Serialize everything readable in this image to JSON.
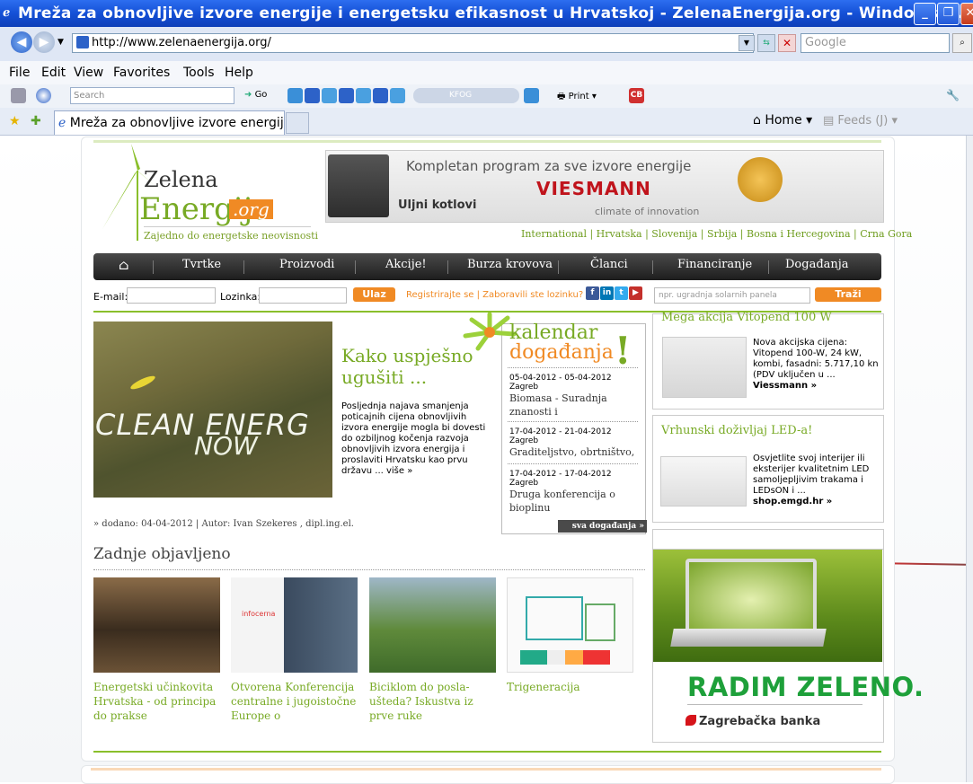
{
  "window": {
    "title": "Mreža za obnovljive izvore energije i energetsku efikasnost u Hrvatskoj - ZelenaEnergija.org - Windows I..."
  },
  "address_bar": {
    "url": "http://www.zelenaenergija.org/",
    "search_placeholder": "Google"
  },
  "menu": [
    "File",
    "Edit",
    "View",
    "Favorites",
    "Tools",
    "Help"
  ],
  "toolbar": {
    "search_placeholder": "Search",
    "go_label": "Go",
    "kfog_label": "KFOG",
    "print_label": "Print"
  },
  "tabs": {
    "active_label": "Mreža za obnovljive izvore energije ...",
    "home_label": "Home",
    "feeds_label": "Feeds (J)"
  },
  "site": {
    "logo_word1": "Zelena",
    "logo_word2": "Energija",
    "logo_tld": ".org",
    "tagline": "Zajedno do energetske neovisnosti",
    "countries": "International | Hrvatska | Slovenija | Srbija | Bosna i Hercegovina | Crna Gora"
  },
  "banner": {
    "headline": "Kompletan program za sve izvore energije",
    "brand": "VIESMANN",
    "subline": "climate of innovation",
    "product": "Uljni kotlovi"
  },
  "nav": [
    "Tvrtke",
    "Proizvodi",
    "Akcije!",
    "Burza krovova",
    "Članci",
    "Financiranje",
    "Događanja"
  ],
  "login": {
    "email_label": "E-mail:",
    "password_label": "Lozinka:",
    "login_button": "Ulaz",
    "register_links": "Registrirajte se | Zaboravili ste lozinku?",
    "search_placeholder": "npr. ugradnja solarnih panela",
    "search_button": "Traži"
  },
  "feature": {
    "image_text_line1": "CLEAN ENERG",
    "image_text_line2": "NOW",
    "title": "Kako uspješno ugušiti ...",
    "text": "Posljednja najava smanjenja poticajnih cijena obnovljivih izvora energije mogla bi dovesti do ozbiljnog kočenja razvoja obnovljivih izvora energija i proslaviti Hrvatsku kao prvu državu ... više »",
    "byline": "» dodano: 04-04-2012 | Autor: Ivan Szekeres , dipl.ing.el."
  },
  "calendar": {
    "title1": "kalendar",
    "title2": "događanja",
    "events": [
      {
        "date": "05-04-2012 - 05-04-2012",
        "city": "Zagreb",
        "title": "Biomasa - Suradnja znanosti i"
      },
      {
        "date": "17-04-2012 - 21-04-2012",
        "city": "Zagreb",
        "title": "Graditeljstvo, obrtništvo,"
      },
      {
        "date": "17-04-2012 - 17-04-2012",
        "city": "Zagreb",
        "title": "Druga konferencija o bioplinu"
      }
    ],
    "all_events": "sva događanja »"
  },
  "ads": {
    "vitopend_title": "Mega akcija Vitopend 100 W",
    "vitopend_text": "Nova akcijska cijena: Vitopend 100-W, 24 kW, kombi, fasadni: 5.717,10 kn (PDV uključen u ...",
    "vitopend_link": "Viessmann »",
    "led_title": "Vrhunski doživljaj LED-a!",
    "led_text": "Osvjetlite svoj interijer ili eksterijer kvalitetnim LED samoljepljivim trakama i LEDsON i ...",
    "led_link": "shop.emgd.hr »",
    "zaba_slogan": "RADIM ZELENO.",
    "zaba_name": "Zagrebačka banka"
  },
  "latest": {
    "heading": "Zadnje objavljeno",
    "items": [
      {
        "title": "Energetski učinkovita Hrvatska - od principa do prakse"
      },
      {
        "title": "Otvorena Konferencija centralne i jugoistočne Europe o"
      },
      {
        "title": "Biciklom do posla- ušteda? Iskustva iz prve ruke"
      },
      {
        "title": "Trigeneracija"
      }
    ],
    "infocerna_label": "infocerna"
  }
}
